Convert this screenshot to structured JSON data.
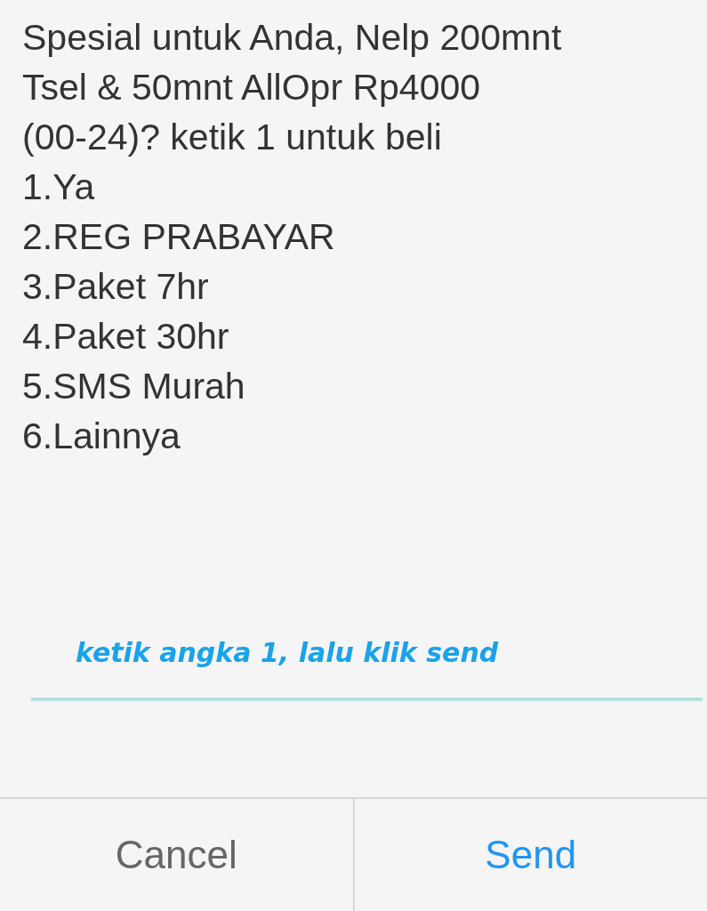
{
  "message": "Spesial untuk Anda, Nelp 200mnt\nTsel & 50mnt AllOpr Rp4000\n(00-24)? ketik 1 untuk beli",
  "options": [
    "1.Ya",
    "2.REG PRABAYAR",
    "3.Paket 7hr",
    "4.Paket 30hr",
    "5.SMS Murah",
    "6.Lainnya"
  ],
  "annotation": "ketik angka 1, lalu klik send",
  "buttons": [
    {
      "label": "Cancel",
      "kind": "neutral"
    },
    {
      "label": "Send",
      "kind": "primary"
    }
  ]
}
